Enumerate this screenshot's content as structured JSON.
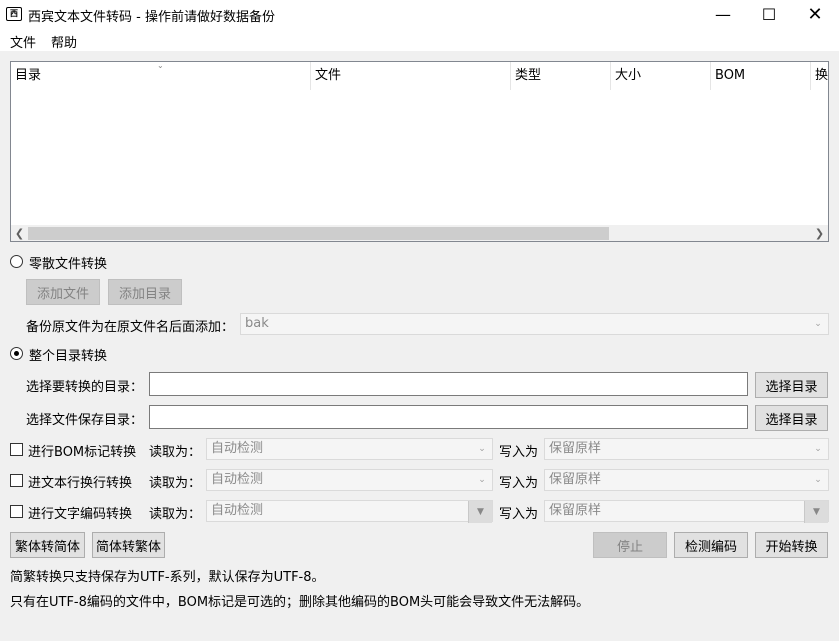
{
  "window": {
    "title": "西宾文本文件转码 - 操作前请做好数据备份",
    "icon_text": "西"
  },
  "menu": [
    "文件",
    "帮助"
  ],
  "table": {
    "columns": [
      "目录",
      "文件",
      "类型",
      "大小",
      "BOM",
      "换"
    ]
  },
  "loose": {
    "radio_label": "零散文件转换",
    "add_file": "添加文件",
    "add_dir": "添加目录",
    "backup_label": "备份原文件为在原文件名后面添加：",
    "backup_value": "bak"
  },
  "whole": {
    "radio_label": "整个目录转换",
    "src_label": "选择要转换的目录：",
    "dst_label": "选择文件保存目录：",
    "choose_dir": "选择目录"
  },
  "options": [
    {
      "label": "进行BOM标记转换",
      "read_label": "读取为：",
      "read_value": "自动检测",
      "write_label": "写入为",
      "write_value": "保留原样"
    },
    {
      "label": "进文本行换行转换",
      "read_label": "读取为：",
      "read_value": "自动检测",
      "write_label": "写入为",
      "write_value": "保留原样"
    },
    {
      "label": "进行文字编码转换",
      "read_label": "读取为：",
      "read_value": "自动检测",
      "write_label": "写入为",
      "write_value": "保留原样"
    }
  ],
  "actions": {
    "trad_to_simp": "繁体转简体",
    "simp_to_trad": "简体转繁体",
    "stop": "停止",
    "detect": "检测编码",
    "start": "开始转换"
  },
  "notes": [
    "简繁转换只支持保存为UTF-系列，默认保存为UTF-8。",
    "只有在UTF-8编码的文件中，BOM标记是可选的；删除其他编码的BOM头可能会导致文件无法解码。"
  ]
}
